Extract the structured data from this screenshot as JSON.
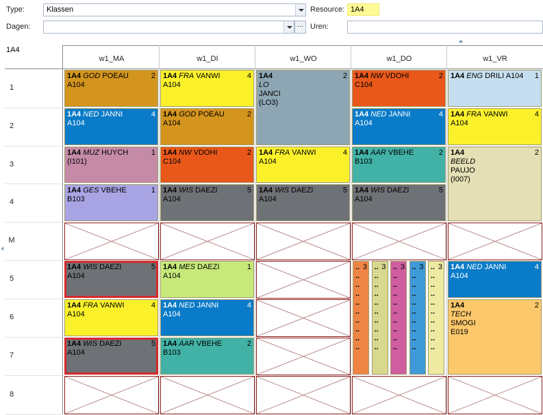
{
  "filters": {
    "type_label": "Type:",
    "type_value": "Klassen",
    "resource_label": "Resource:",
    "resource_value": "1A4",
    "dagen_label": "Dagen:",
    "dagen_value": "",
    "uren_label": "Uren:",
    "uren_value": "",
    "ellipsis": "···"
  },
  "grid": {
    "corner_label": "1A4",
    "days": [
      "w1_MA",
      "w1_DI",
      "w1_WO",
      "w1_DO",
      "w1_VR"
    ],
    "periods": [
      "1",
      "2",
      "3",
      "4",
      "M",
      "5",
      "6",
      "7",
      "8"
    ]
  },
  "lessons": [
    {
      "day": 0,
      "period": "1",
      "cls": "1A4",
      "subj": "GOD",
      "teacher": "POEAU",
      "room": "A104",
      "count": "2",
      "color": "#d4951e"
    },
    {
      "day": 0,
      "period": "2",
      "cls": "1A4",
      "subj": "NED",
      "teacher": "JANNI",
      "room": "A104",
      "count": "4",
      "color": "#0a7bc8"
    },
    {
      "day": 0,
      "period": "3",
      "cls": "1A4",
      "subj": "MUZ",
      "teacher": "HUYCH",
      "room": "(I101)",
      "count": "1",
      "color": "#c48aa6"
    },
    {
      "day": 0,
      "period": "4",
      "cls": "1A4",
      "subj": "GES",
      "teacher": "VBEHE",
      "room": "B103",
      "count": "1",
      "color": "#a9a4e4"
    },
    {
      "day": 0,
      "period": "5",
      "cls": "1A4",
      "subj": "WIS",
      "teacher": "DAEZI",
      "room": "A104",
      "count": "5",
      "color": "#6e7176",
      "selected": true
    },
    {
      "day": 0,
      "period": "6",
      "cls": "1A4",
      "subj": "FRA",
      "teacher": "VANWI",
      "room": "A104",
      "count": "4",
      "color": "#fbf12b"
    },
    {
      "day": 0,
      "period": "7",
      "cls": "1A4",
      "subj": "WIS",
      "teacher": "DAEZI",
      "room": "A104",
      "count": "5",
      "color": "#6e7176",
      "selected": true
    },
    {
      "day": 1,
      "period": "1",
      "cls": "1A4",
      "subj": "FRA",
      "teacher": "VANWI",
      "room": "A104",
      "count": "4",
      "color": "#fbf12b"
    },
    {
      "day": 1,
      "period": "2",
      "cls": "1A4",
      "subj": "GOD",
      "teacher": "POEAU",
      "room": "A104",
      "count": "2",
      "color": "#d4951e"
    },
    {
      "day": 1,
      "period": "3",
      "cls": "1A4",
      "subj": "NW",
      "teacher": "VDOHI",
      "room": "C104",
      "count": "2",
      "color": "#e9581a"
    },
    {
      "day": 1,
      "period": "4",
      "cls": "1A4",
      "subj": "WIS",
      "teacher": "DAEZI",
      "room": "A104",
      "count": "5",
      "color": "#6e7176"
    },
    {
      "day": 1,
      "period": "5",
      "cls": "1A4",
      "subj": "MES",
      "teacher": "DAEZI",
      "room": "A104",
      "count": "1",
      "color": "#c6e97a"
    },
    {
      "day": 1,
      "period": "6",
      "cls": "1A4",
      "subj": "NED",
      "teacher": "JANNI",
      "room": "A104",
      "count": "4",
      "color": "#0a7bc8"
    },
    {
      "day": 1,
      "period": "7",
      "cls": "1A4",
      "subj": "AAR",
      "teacher": "VBEHE",
      "room": "B103",
      "count": "2",
      "color": "#42b2a6"
    },
    {
      "day": 2,
      "period": "3",
      "cls": "1A4",
      "subj": "FRA",
      "teacher": "VANWI",
      "room": "A104",
      "count": "4",
      "color": "#fbf12b"
    },
    {
      "day": 2,
      "period": "4",
      "cls": "1A4",
      "subj": "WIS",
      "teacher": "DAEZI",
      "room": "A104",
      "count": "5",
      "color": "#6e7176"
    },
    {
      "day": 3,
      "period": "1",
      "cls": "1A4",
      "subj": "NW",
      "teacher": "VDOHI",
      "room": "C104",
      "count": "2",
      "color": "#e9581a"
    },
    {
      "day": 3,
      "period": "2",
      "cls": "1A4",
      "subj": "NED",
      "teacher": "JANNI",
      "room": "A104",
      "count": "4",
      "color": "#0a7bc8"
    },
    {
      "day": 3,
      "period": "3",
      "cls": "1A4",
      "subj": "AAR",
      "teacher": "VBEHE",
      "room": "B103",
      "count": "2",
      "color": "#42b2a6"
    },
    {
      "day": 3,
      "period": "4",
      "cls": "1A4",
      "subj": "WIS",
      "teacher": "DAEZI",
      "room": "A104",
      "count": "5",
      "color": "#6e7176"
    },
    {
      "day": 4,
      "period": "1",
      "cls": "1A4",
      "subj": "ENG",
      "teacher": "DRILI",
      "room": "A104",
      "count": "1",
      "color": "#c6dff0",
      "inline_room": true
    },
    {
      "day": 4,
      "period": "2",
      "cls": "1A4",
      "subj": "FRA",
      "teacher": "VANWI",
      "room": "A104",
      "count": "4",
      "color": "#fbf12b"
    },
    {
      "day": 4,
      "period": "5",
      "cls": "1A4",
      "subj": "NED",
      "teacher": "JANNI",
      "room": "A104",
      "count": "4",
      "color": "#0a7bc8"
    }
  ],
  "tall_lessons": [
    {
      "day": 2,
      "from": "1",
      "to": "2",
      "cls": "1A4",
      "subj": "LO",
      "teacher": "JANCI",
      "room": "(LO3)",
      "count": "2",
      "color": "#8ea6b4"
    },
    {
      "day": 4,
      "from": "3",
      "to": "4",
      "cls": "1A4",
      "subj": "BEELD",
      "teacher": "PAUJO",
      "room": "(I007)",
      "count": "2",
      "color": "#e4dfb4"
    },
    {
      "day": 4,
      "from": "6",
      "to": "7",
      "cls": "1A4",
      "subj": "TECH",
      "teacher": "SMOGI",
      "room": "E019",
      "count": "2",
      "color": "#fcc86c"
    }
  ],
  "split_block": {
    "day": 3,
    "count": "3",
    "dots": "..",
    "colors": [
      "#ef8545",
      "#d9d88f",
      "#cf5d9f",
      "#3d9ad6",
      "#eeeaa2"
    ]
  }
}
